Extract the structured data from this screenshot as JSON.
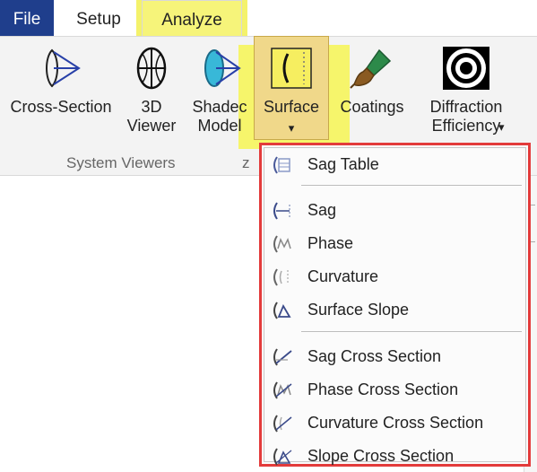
{
  "tabs": {
    "file": "File",
    "setup": "Setup",
    "analyze": "Analyze"
  },
  "ribbon": {
    "cross_section": "Cross-Section",
    "viewer_3d": "3D\nViewer",
    "shaded_model": "Shadec\nModel",
    "surface": "Surface",
    "coatings": "Coatings",
    "diffraction_efficiency": "Diffraction\nEfficiency",
    "dropdown_arrow": "▾",
    "group_system_viewers": "System Viewers",
    "group_cut": "z"
  },
  "menu": {
    "items": [
      {
        "label": "Sag Table",
        "icon": "sag-table-icon"
      },
      {
        "label": "Sag",
        "icon": "sag-icon"
      },
      {
        "label": "Phase",
        "icon": "phase-icon"
      },
      {
        "label": "Curvature",
        "icon": "curvature-icon"
      },
      {
        "label": "Surface Slope",
        "icon": "surface-slope-icon"
      },
      {
        "label": "Sag Cross Section",
        "icon": "sag-cross-section-icon"
      },
      {
        "label": "Phase Cross Section",
        "icon": "phase-cross-section-icon"
      },
      {
        "label": "Curvature Cross Section",
        "icon": "curvature-cross-section-icon"
      },
      {
        "label": "Slope Cross Section",
        "icon": "slope-cross-section-icon"
      }
    ]
  },
  "colors": {
    "highlight": "#f4f26b",
    "file_tab": "#1f3e8c",
    "menu_border": "#e33b3b"
  }
}
